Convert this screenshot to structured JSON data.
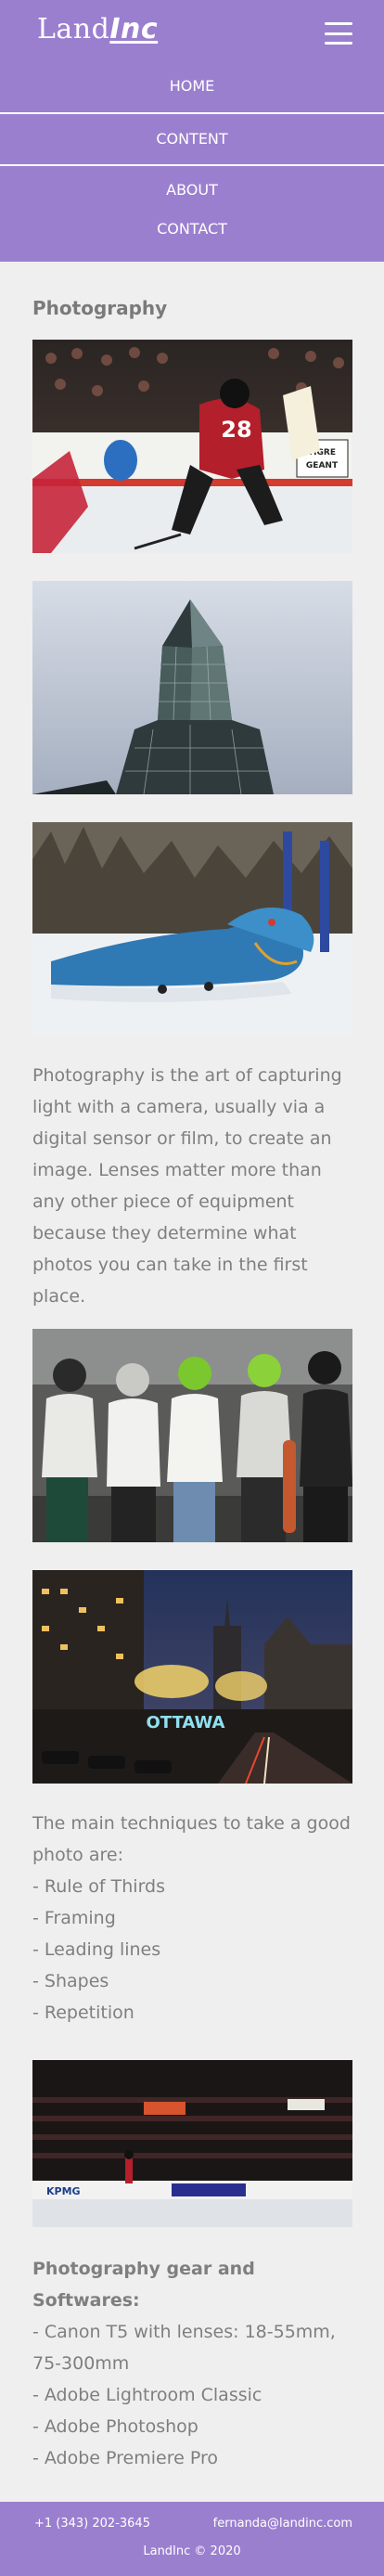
{
  "brand": {
    "logo_left": "Land",
    "logo_right": "Inc"
  },
  "nav": {
    "items": [
      "HOME",
      "CONTENT",
      "ABOUT",
      "CONTACT"
    ]
  },
  "page": {
    "title": "Photography"
  },
  "intro_text": "Photography is the art of capturing light with a camera, usually via a digital sensor or film, to create an image. Lenses matter more than any other piece of equipment because they determine what photos you can take in the first place.",
  "techniques": {
    "heading": "The main techniques to take a good photo are:",
    "items": [
      "- Rule of Thirds",
      "- Framing",
      "- Leading lines",
      "- Shapes",
      "- Repetition"
    ]
  },
  "gear": {
    "heading": "Photography gear and Softwares:",
    "items": [
      "- Canon T5 with lenses: 18-55mm, 75-300mm",
      "- Adobe Lightroom Classic",
      "- Adobe Photoshop",
      "- Adobe Premiere Pro"
    ]
  },
  "footer": {
    "phone": "+1 (343) 202-3645",
    "email": "fernanda@landinc.com",
    "copyright": "LandInc © 2020"
  },
  "photos": {
    "hockey": {
      "jersey_number": "28",
      "ad_text_1": "TIGRE",
      "ad_text_2": "GEANT"
    },
    "ottawa": {
      "sign": "OTTAWA"
    },
    "arena": {
      "ad_kpmg": "KPMG"
    }
  },
  "colors": {
    "header": "#9b7fcf",
    "background": "#efefef",
    "text": "#7a7a7a"
  }
}
